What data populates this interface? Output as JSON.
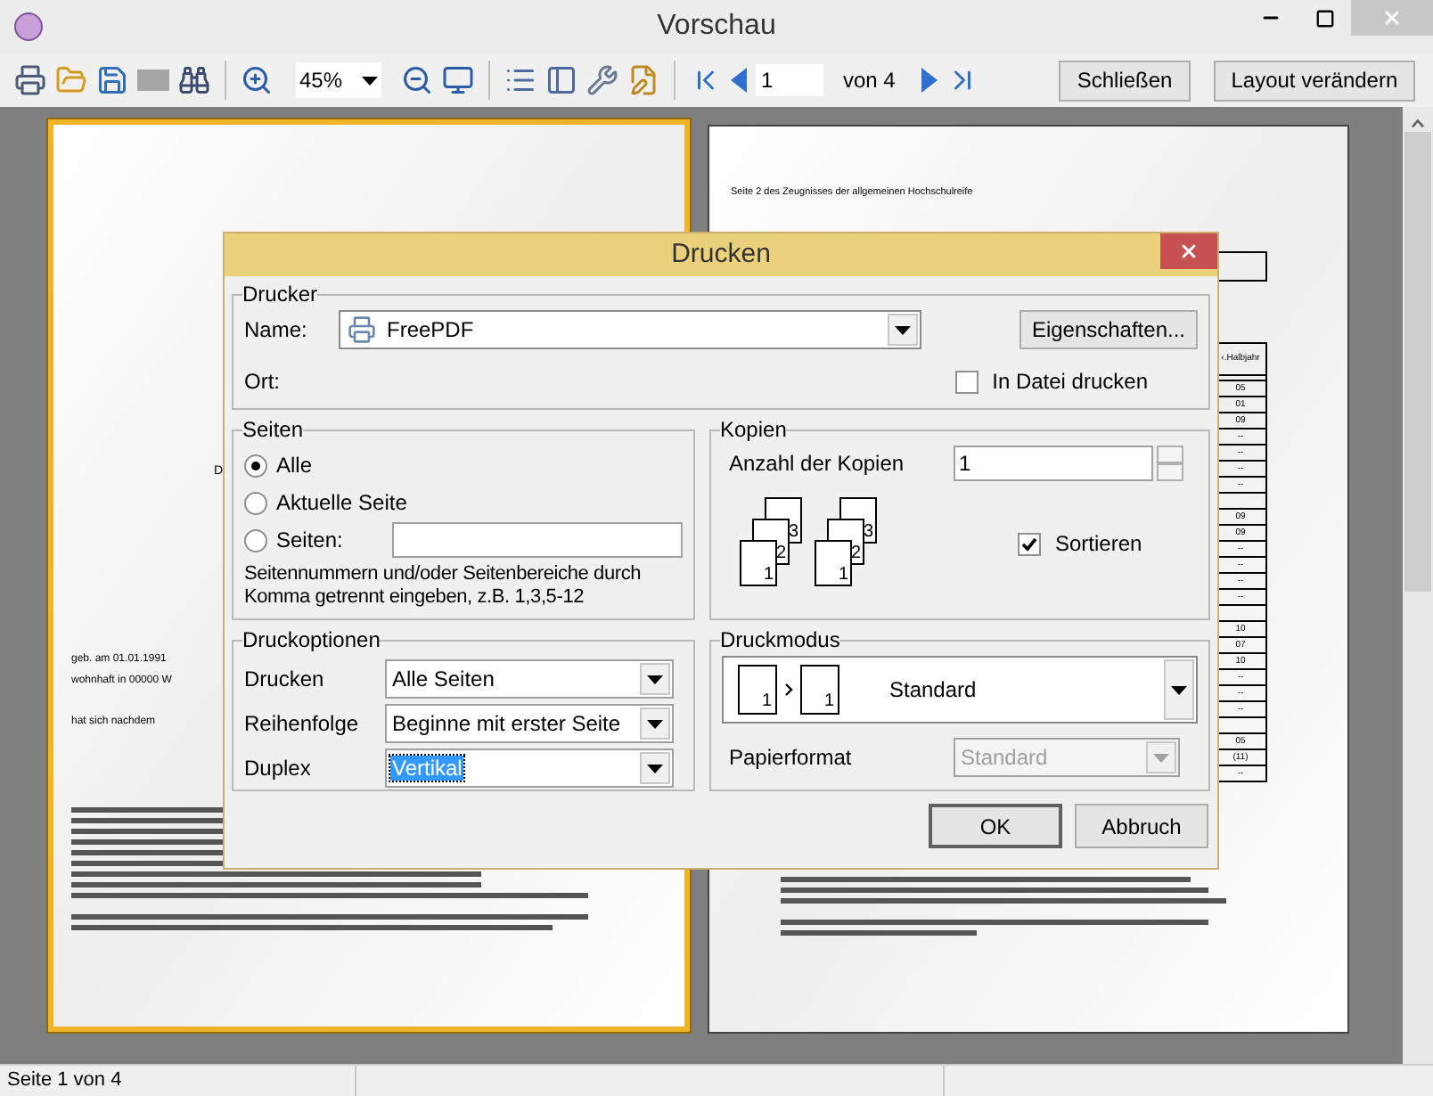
{
  "window": {
    "title": "Vorschau"
  },
  "toolbar": {
    "zoom": "45%",
    "page": "1",
    "page_count": "von 4",
    "buttons": [
      "Schließen",
      "Layout verändern"
    ]
  },
  "pages": [
    {
      "selected": true,
      "initial": "D",
      "lines": [
        "geb. am 01.01.1991",
        "wohnhaft in 00000 W",
        "hat sich nachdem"
      ]
    },
    {
      "selected": false,
      "header": "Seite 2 des Zeugnisses der allgemeinen Hochschulreife",
      "table": {
        "header": "‹.Halbjahr",
        "groups": [
          [
            "05",
            "01",
            "09",
            "--",
            "--",
            "--",
            "--"
          ],
          [
            "09",
            "09",
            "--",
            "--",
            "--",
            "--"
          ],
          [
            "10",
            "07",
            "10",
            "--",
            "--",
            "--"
          ],
          [
            "05",
            "(11)",
            "--"
          ]
        ]
      }
    }
  ],
  "dialog": {
    "title": "Drucken",
    "printer": {
      "legend": "Drucker",
      "name_label": "Name:",
      "name": "FreePDF",
      "properties": "Eigenschaften...",
      "location_label": "Ort:",
      "to_file": {
        "label": "In Datei drucken",
        "checked": false
      }
    },
    "pages": {
      "legend": "Seiten",
      "options": [
        {
          "label": "Alle",
          "selected": true
        },
        {
          "label": "Aktuelle Seite",
          "selected": false
        },
        {
          "label": "Seiten:",
          "selected": false
        }
      ],
      "hint": "Seitennummern und/oder Seitenbereiche durch Komma getrennt eingeben, z.B. 1,3,5-12"
    },
    "copies": {
      "legend": "Kopien",
      "count_label": "Anzahl der Kopien",
      "count": "1",
      "stacks": [
        [
          "1",
          "2",
          "3"
        ],
        [
          "1",
          "2",
          "3"
        ]
      ],
      "collate": {
        "label": "Sortieren",
        "checked": true
      }
    },
    "options": {
      "legend": "Druckoptionen",
      "rows": [
        {
          "label": "Drucken",
          "value": "Alle Seiten",
          "focused": false
        },
        {
          "label": "Reihenfolge",
          "value": "Beginne mit erster Seite",
          "focused": false
        },
        {
          "label": "Duplex",
          "value": "Vertikal",
          "focused": true
        }
      ]
    },
    "mode": {
      "legend": "Druckmodus",
      "pages": [
        "1",
        "1"
      ],
      "value": "Standard",
      "paper_label": "Papierformat",
      "paper": "Standard",
      "paper_disabled": true
    },
    "buttons": [
      {
        "label": "OK",
        "default": true
      },
      {
        "label": "Abbruch",
        "default": false
      }
    ]
  },
  "status_bar": {
    "text": "Seite 1 von 4"
  }
}
